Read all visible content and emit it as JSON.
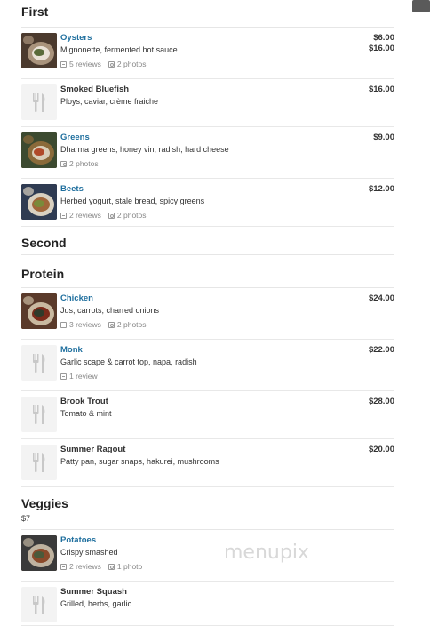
{
  "sections": [
    {
      "title": "First",
      "subtitle": "",
      "items": [
        {
          "name": "Oysters",
          "desc": "Mignonette, fermented hot sauce",
          "prices": [
            "$6.00",
            "$16.00"
          ],
          "reviews": "5 reviews",
          "photos": "2 photos",
          "linked": true,
          "thumb": "photo",
          "height": 58
        },
        {
          "name": "Smoked Bluefish",
          "desc": "Ploys, caviar, crème fraiche",
          "prices": [
            "$16.00"
          ],
          "reviews": "",
          "photos": "",
          "linked": false,
          "thumb": "placeholder",
          "height": 54
        },
        {
          "name": "Greens",
          "desc": "Dharma greens, honey vin, radish, hard cheese",
          "prices": [
            "$9.00"
          ],
          "reviews": "",
          "photos": "2 photos",
          "linked": true,
          "thumb": "photo",
          "height": 58
        },
        {
          "name": "Beets",
          "desc": "Herbed yogurt, stale bread, spicy greens",
          "prices": [
            "$12.00"
          ],
          "reviews": "2 reviews",
          "photos": "2 photos",
          "linked": true,
          "thumb": "photo",
          "height": 54
        }
      ]
    },
    {
      "title": "Second",
      "subtitle": "",
      "items": []
    },
    {
      "title": "Protein",
      "subtitle": "",
      "items": [
        {
          "name": "Chicken",
          "desc": "Jus, carrots, charred onions",
          "prices": [
            "$24.00"
          ],
          "reviews": "3 reviews",
          "photos": "2 photos",
          "linked": true,
          "thumb": "photo",
          "height": 58
        },
        {
          "name": "Monk",
          "desc": "Garlic scape & carrot top, napa, radish",
          "prices": [
            "$22.00"
          ],
          "reviews": "1 review",
          "photos": "",
          "linked": true,
          "thumb": "placeholder",
          "height": 58
        },
        {
          "name": "Brook Trout",
          "desc": "Tomato & mint",
          "prices": [
            "$28.00"
          ],
          "reviews": "",
          "photos": "",
          "linked": false,
          "thumb": "placeholder",
          "height": 54
        },
        {
          "name": "Summer Ragout",
          "desc": "Patty pan, sugar snaps, hakurei, mushrooms",
          "prices": [
            "$20.00"
          ],
          "reviews": "",
          "photos": "",
          "linked": false,
          "thumb": "placeholder",
          "height": 54
        }
      ]
    },
    {
      "title": "Veggies",
      "subtitle": "$7",
      "items": [
        {
          "name": "Potatoes",
          "desc": "Crispy smashed",
          "prices": [],
          "reviews": "2 reviews",
          "photos": "1 photo",
          "linked": true,
          "thumb": "photo",
          "height": 58
        },
        {
          "name": "Summer Squash",
          "desc": "Grilled, herbs, garlic",
          "prices": [],
          "reviews": "",
          "photos": "",
          "linked": false,
          "thumb": "placeholder",
          "height": 50
        }
      ]
    }
  ],
  "watermark": "menupix",
  "colors": {
    "link": "#1f6f9e",
    "text": "#333333",
    "meta": "#888888",
    "divider": "#e8e8e8"
  }
}
